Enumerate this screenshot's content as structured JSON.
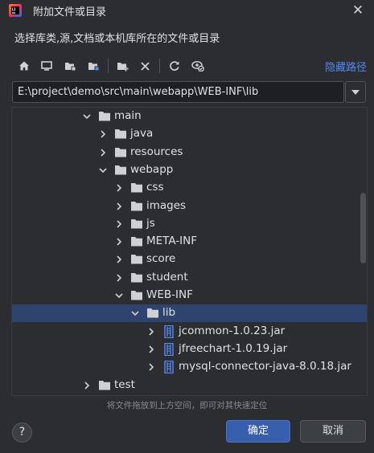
{
  "window": {
    "title": "附加文件或目录",
    "close_icon": "close-icon",
    "app_icon": "intellij-idea-icon"
  },
  "description": "选择库类,源,文档或本机库所在的文件或目录",
  "toolbar": {
    "buttons": [
      {
        "icon": "home-icon"
      },
      {
        "icon": "desktop-icon"
      },
      {
        "icon": "project-folder-icon"
      },
      {
        "icon": "module-folder-icon"
      },
      {
        "icon": "new-folder-icon"
      },
      {
        "icon": "delete-icon"
      },
      {
        "icon": "refresh-icon"
      },
      {
        "icon": "show-hidden-icon"
      }
    ],
    "hide_path_label": "隐藏路径"
  },
  "path": {
    "value": "E:\\project\\demo\\src\\main\\webapp\\WEB-INF\\lib"
  },
  "tree": {
    "rows": [
      {
        "label": "main",
        "type": "folder",
        "expanded": true,
        "depth": 0
      },
      {
        "label": "java",
        "type": "folder",
        "expanded": false,
        "depth": 1
      },
      {
        "label": "resources",
        "type": "folder",
        "expanded": false,
        "depth": 1
      },
      {
        "label": "webapp",
        "type": "folder",
        "expanded": true,
        "depth": 1
      },
      {
        "label": "css",
        "type": "folder",
        "expanded": false,
        "depth": 2
      },
      {
        "label": "images",
        "type": "folder",
        "expanded": false,
        "depth": 2
      },
      {
        "label": "js",
        "type": "folder",
        "expanded": false,
        "depth": 2
      },
      {
        "label": "META-INF",
        "type": "folder",
        "expanded": false,
        "depth": 2
      },
      {
        "label": "score",
        "type": "folder",
        "expanded": false,
        "depth": 2
      },
      {
        "label": "student",
        "type": "folder",
        "expanded": false,
        "depth": 2
      },
      {
        "label": "WEB-INF",
        "type": "folder",
        "expanded": true,
        "depth": 2
      },
      {
        "label": "lib",
        "type": "folder",
        "expanded": true,
        "depth": 3,
        "selected": true
      },
      {
        "label": "jcommon-1.0.23.jar",
        "type": "jar",
        "expanded": false,
        "depth": 4
      },
      {
        "label": "jfreechart-1.0.19.jar",
        "type": "jar",
        "expanded": false,
        "depth": 4
      },
      {
        "label": "mysql-connector-java-8.0.18.jar",
        "type": "jar",
        "expanded": false,
        "depth": 4
      },
      {
        "label": "test",
        "type": "folder",
        "expanded": false,
        "depth": 0
      }
    ]
  },
  "hint": "将文件拖放到上方空间，即可对其快速定位",
  "buttons": {
    "help_label": "?",
    "ok_label": "确定",
    "cancel_label": "取消"
  },
  "colors": {
    "background": "#2b2d30",
    "selection": "#2e436e",
    "accent": "#375fad",
    "link": "#548af7",
    "folder": "#ced0d6",
    "jar": "#548af7"
  }
}
